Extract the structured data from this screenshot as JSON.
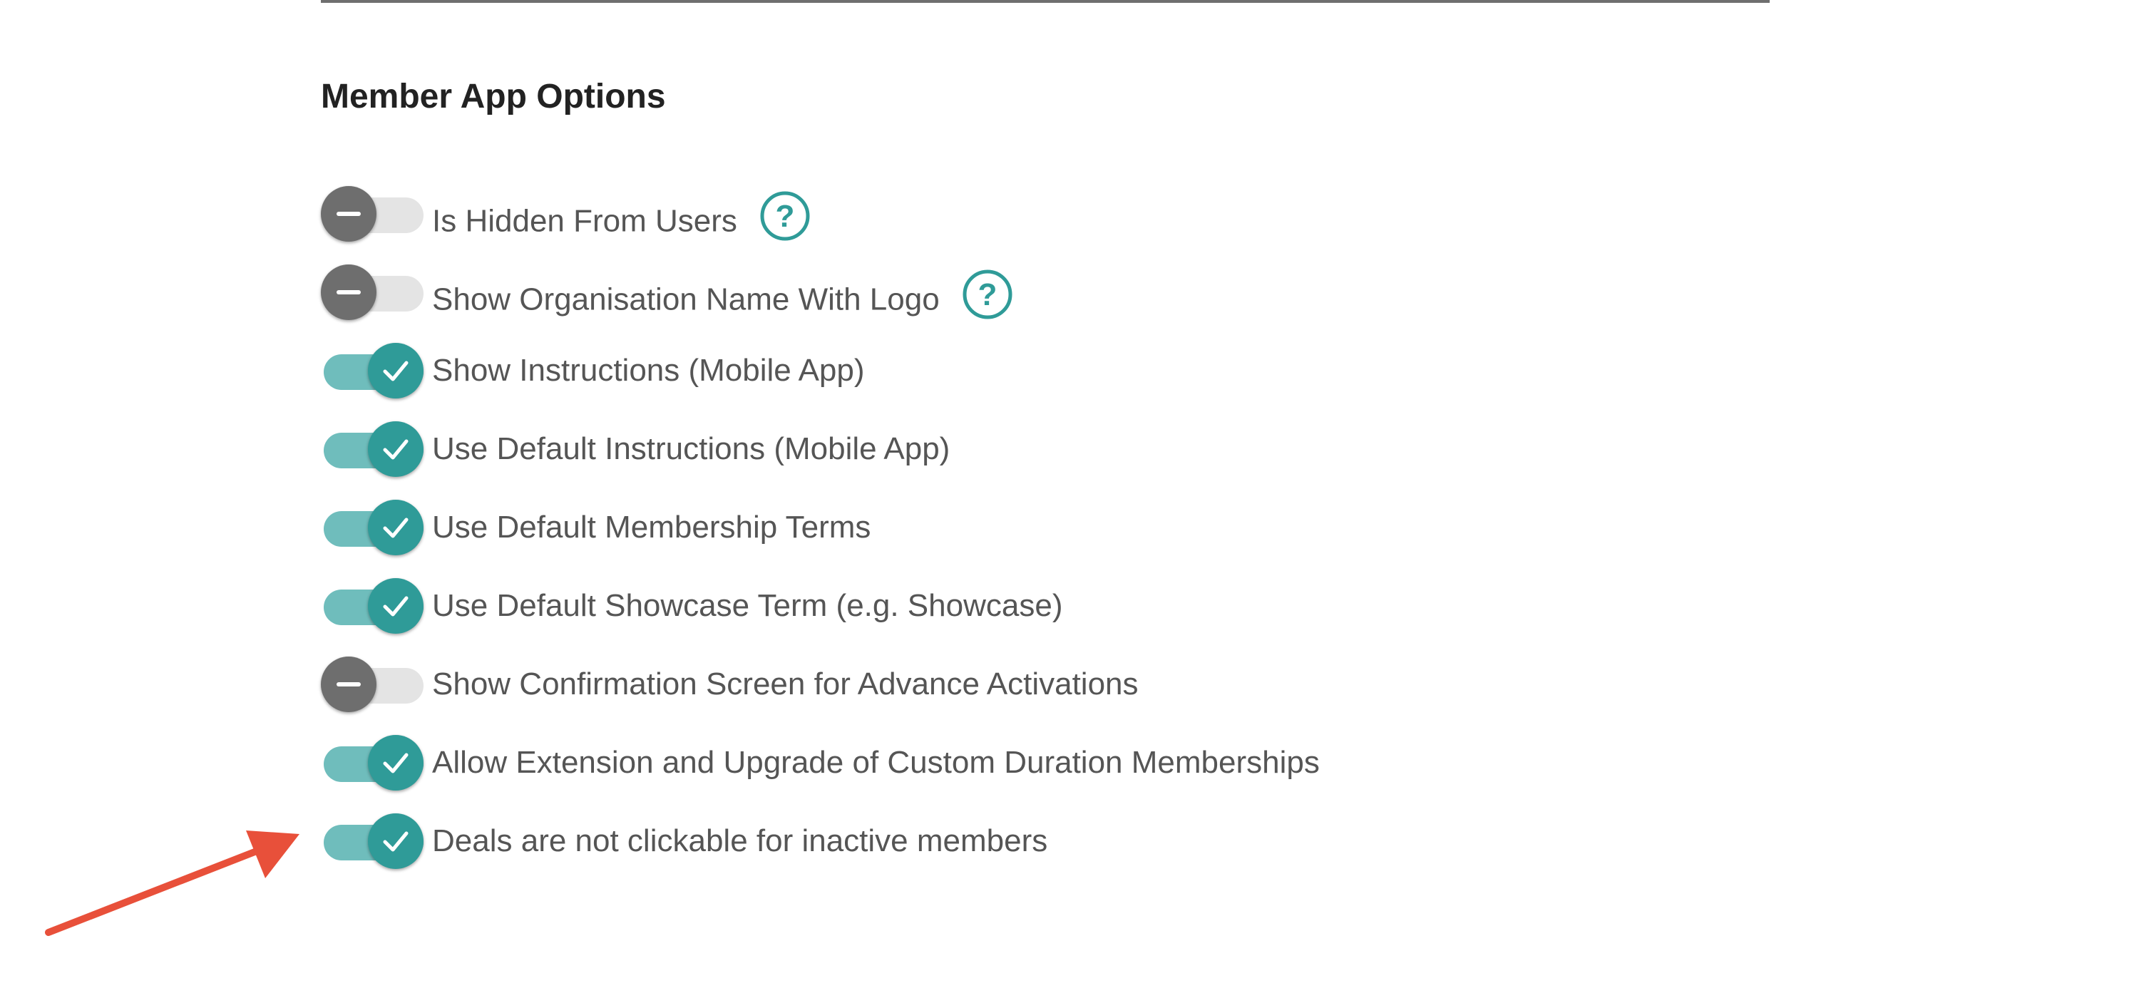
{
  "section": {
    "title": "Member App Options"
  },
  "colors": {
    "accent": "#2f9b98",
    "accent_track": "#6fbdbc",
    "off_knob": "#6e6e6e",
    "off_track": "#e4e4e4",
    "annotation_arrow": "#e8503a"
  },
  "options": [
    {
      "label": "Is Hidden From Users",
      "enabled": false,
      "has_help": true,
      "help_icon": "question-circle-icon"
    },
    {
      "label": "Show Organisation Name With Logo",
      "enabled": false,
      "has_help": true,
      "help_icon": "question-circle-icon"
    },
    {
      "label": "Show Instructions (Mobile App)",
      "enabled": true,
      "has_help": false
    },
    {
      "label": "Use Default Instructions (Mobile App)",
      "enabled": true,
      "has_help": false
    },
    {
      "label": "Use Default Membership Terms",
      "enabled": true,
      "has_help": false
    },
    {
      "label": "Use Default Showcase Term (e.g. Showcase)",
      "enabled": true,
      "has_help": false
    },
    {
      "label": "Show Confirmation Screen for Advance Activations",
      "enabled": false,
      "has_help": false
    },
    {
      "label": "Allow Extension and Upgrade of Custom Duration Memberships",
      "enabled": true,
      "has_help": false
    },
    {
      "label": "Deals are not clickable for inactive members",
      "enabled": true,
      "has_help": false
    }
  ],
  "annotation": {
    "icon": "red-arrow-icon",
    "points_to": "Deals are not clickable for inactive members"
  }
}
